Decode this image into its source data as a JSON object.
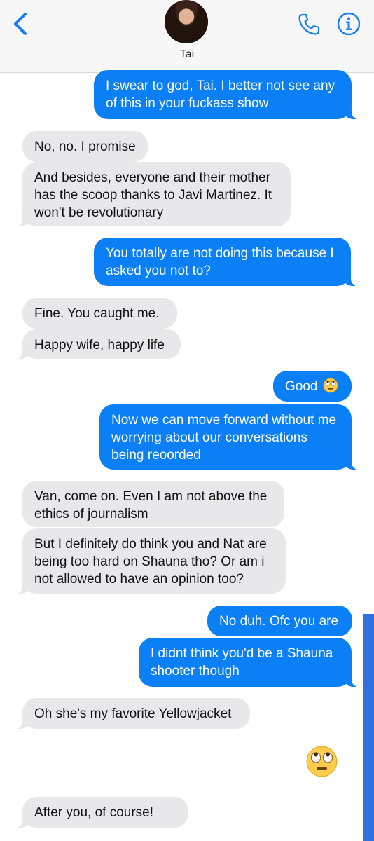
{
  "header": {
    "contact_name": "Tai"
  },
  "messages": [
    {
      "id": "m1",
      "text": "I swear to god, Tai. I better not see any of this in your fuckass show"
    },
    {
      "id": "m2",
      "text": "No, no. I promise"
    },
    {
      "id": "m3",
      "text": "And besides, everyone and their mother has the scoop thanks to Javi Martinez. It won't be revolutionary"
    },
    {
      "id": "m4",
      "text": "You totally are not doing this because I asked you not to?"
    },
    {
      "id": "m5",
      "text": "Fine. You caught me."
    },
    {
      "id": "m6",
      "text": "Happy wife, happy life"
    },
    {
      "id": "m7",
      "text": "Good"
    },
    {
      "id": "m8",
      "text": "Now we can move forward without me worrying about our conversations being reoorded"
    },
    {
      "id": "m9",
      "text": "Van, come on. Even I am not above the ethics of journalism"
    },
    {
      "id": "m10",
      "text": "But I definitely do think you and Nat are being too hard on Shauna tho? Or am i not allowed to have an opinion too?"
    },
    {
      "id": "m11",
      "text": "No duh. Ofc you are"
    },
    {
      "id": "m12",
      "text": "I didnt think you'd be a Shauna shooter though"
    },
    {
      "id": "m13",
      "text": "Oh she's my favorite Yellowjacket"
    },
    {
      "id": "m14",
      "text": "After you, of course!"
    }
  ],
  "colors": {
    "outgoing": "#0b7ff6",
    "incoming": "#e8e8ea",
    "accent": "#1a7cf5"
  },
  "icons": {
    "back": "chevron-left-icon",
    "call": "phone-icon",
    "info": "info-icon",
    "eye_roll": "face-with-rolling-eyes-icon"
  }
}
